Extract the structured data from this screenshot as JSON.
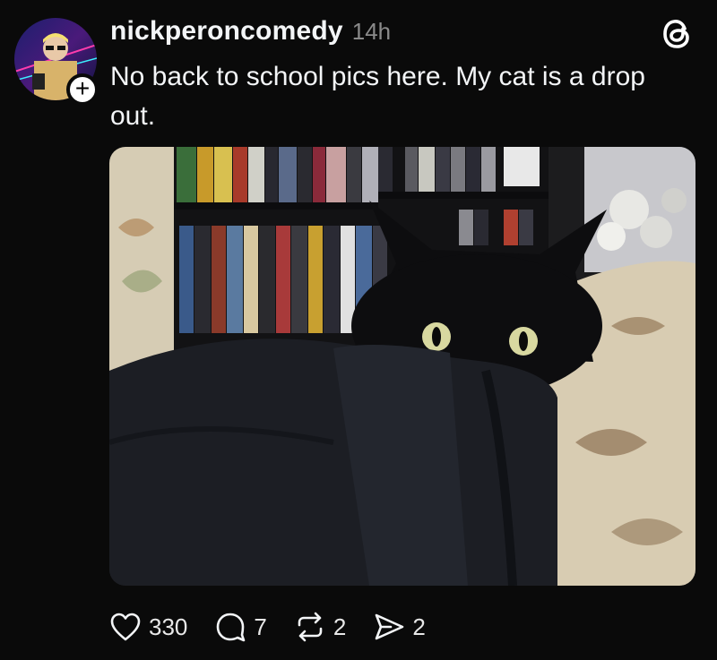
{
  "post": {
    "username": "nickperoncomedy",
    "timestamp": "14h",
    "caption": "No back to school pics here. My cat is a drop out.",
    "follow_glyph": "+"
  },
  "actions": {
    "likes": "330",
    "replies": "7",
    "reposts": "2",
    "shares": "2"
  },
  "icons": {
    "like": "heart-icon",
    "reply": "comment-bubble-icon",
    "repost": "repost-arrows-icon",
    "share": "send-icon",
    "brand": "threads-logo-icon"
  },
  "colors": {
    "background": "#0a0a0a",
    "text": "#f3f5f7",
    "muted": "#8a8a8a"
  }
}
